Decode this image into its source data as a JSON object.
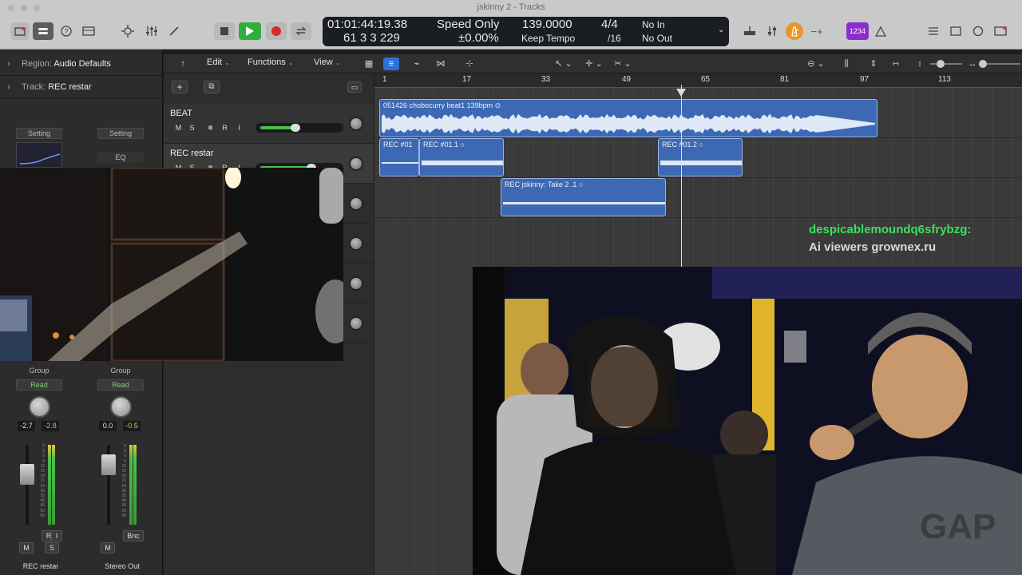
{
  "window": {
    "title": "jskinny 2 - Tracks"
  },
  "control_bar": {
    "lcd": {
      "time": "01:01:44:19.38",
      "bars": "61  3  3  229",
      "mode": "Speed Only",
      "pitch": "±0.00%",
      "tempo": "139.0000",
      "tempo_mode": "Keep Tempo",
      "signature_top": "4/4",
      "signature_bottom": "/16",
      "in_label": "No In",
      "out_label": "No Out"
    },
    "badge": "1234"
  },
  "inspector": {
    "region_label": "Region:",
    "region_value": "Audio Defaults",
    "track_label": "Track:",
    "track_value": "REC restar",
    "setting_label": "Setting",
    "eq_label": "EQ",
    "group_label": "Group",
    "read_label": "Read",
    "strips": [
      {
        "name": "REC restar",
        "pan_values": [
          "-2.7",
          "-2.8"
        ],
        "buttons": [
          "M",
          "S"
        ],
        "extra": [
          "R",
          "I"
        ]
      },
      {
        "name": "Stereo Out",
        "pan_values": [
          "0.0",
          "-0.5"
        ],
        "buttons": [
          "M"
        ],
        "extra": [
          "Bnc"
        ]
      }
    ],
    "scale": [
      "0",
      "3",
      "6",
      "9",
      "12",
      "15",
      "18",
      "21",
      "24",
      "30",
      "35",
      "40",
      "45",
      "50",
      "60"
    ]
  },
  "menubar": {
    "items": [
      "Edit",
      "Functions",
      "View"
    ]
  },
  "tracks": [
    {
      "name": "BEAT",
      "buttons": [
        "M",
        "S",
        "❄",
        "R",
        "I"
      ],
      "volume": 0.45
    },
    {
      "name": "REC restar",
      "buttons": [
        "M",
        "S",
        "❄",
        "R",
        "I"
      ],
      "volume": 0.65
    }
  ],
  "ruler": {
    "bars": [
      "1",
      "17",
      "33",
      "49",
      "65",
      "81",
      "97",
      "113"
    ]
  },
  "regions": [
    {
      "name": "051426 chobocurry beat1 139bpm",
      "track": 0
    },
    {
      "name": "REC #01",
      "track": 1
    },
    {
      "name": "REC #01.1",
      "track": 1
    },
    {
      "name": "REC #01.2",
      "track": 1
    },
    {
      "name": "REC jskinny: Take 2 .1",
      "track": 2
    }
  ],
  "overlay": {
    "line1": "despicablemoundq6sfrybzg:",
    "line2": "Ai viewers grownex.ru",
    "line1_color": "#3ee05b",
    "line2_color": "#d9d9d9"
  }
}
